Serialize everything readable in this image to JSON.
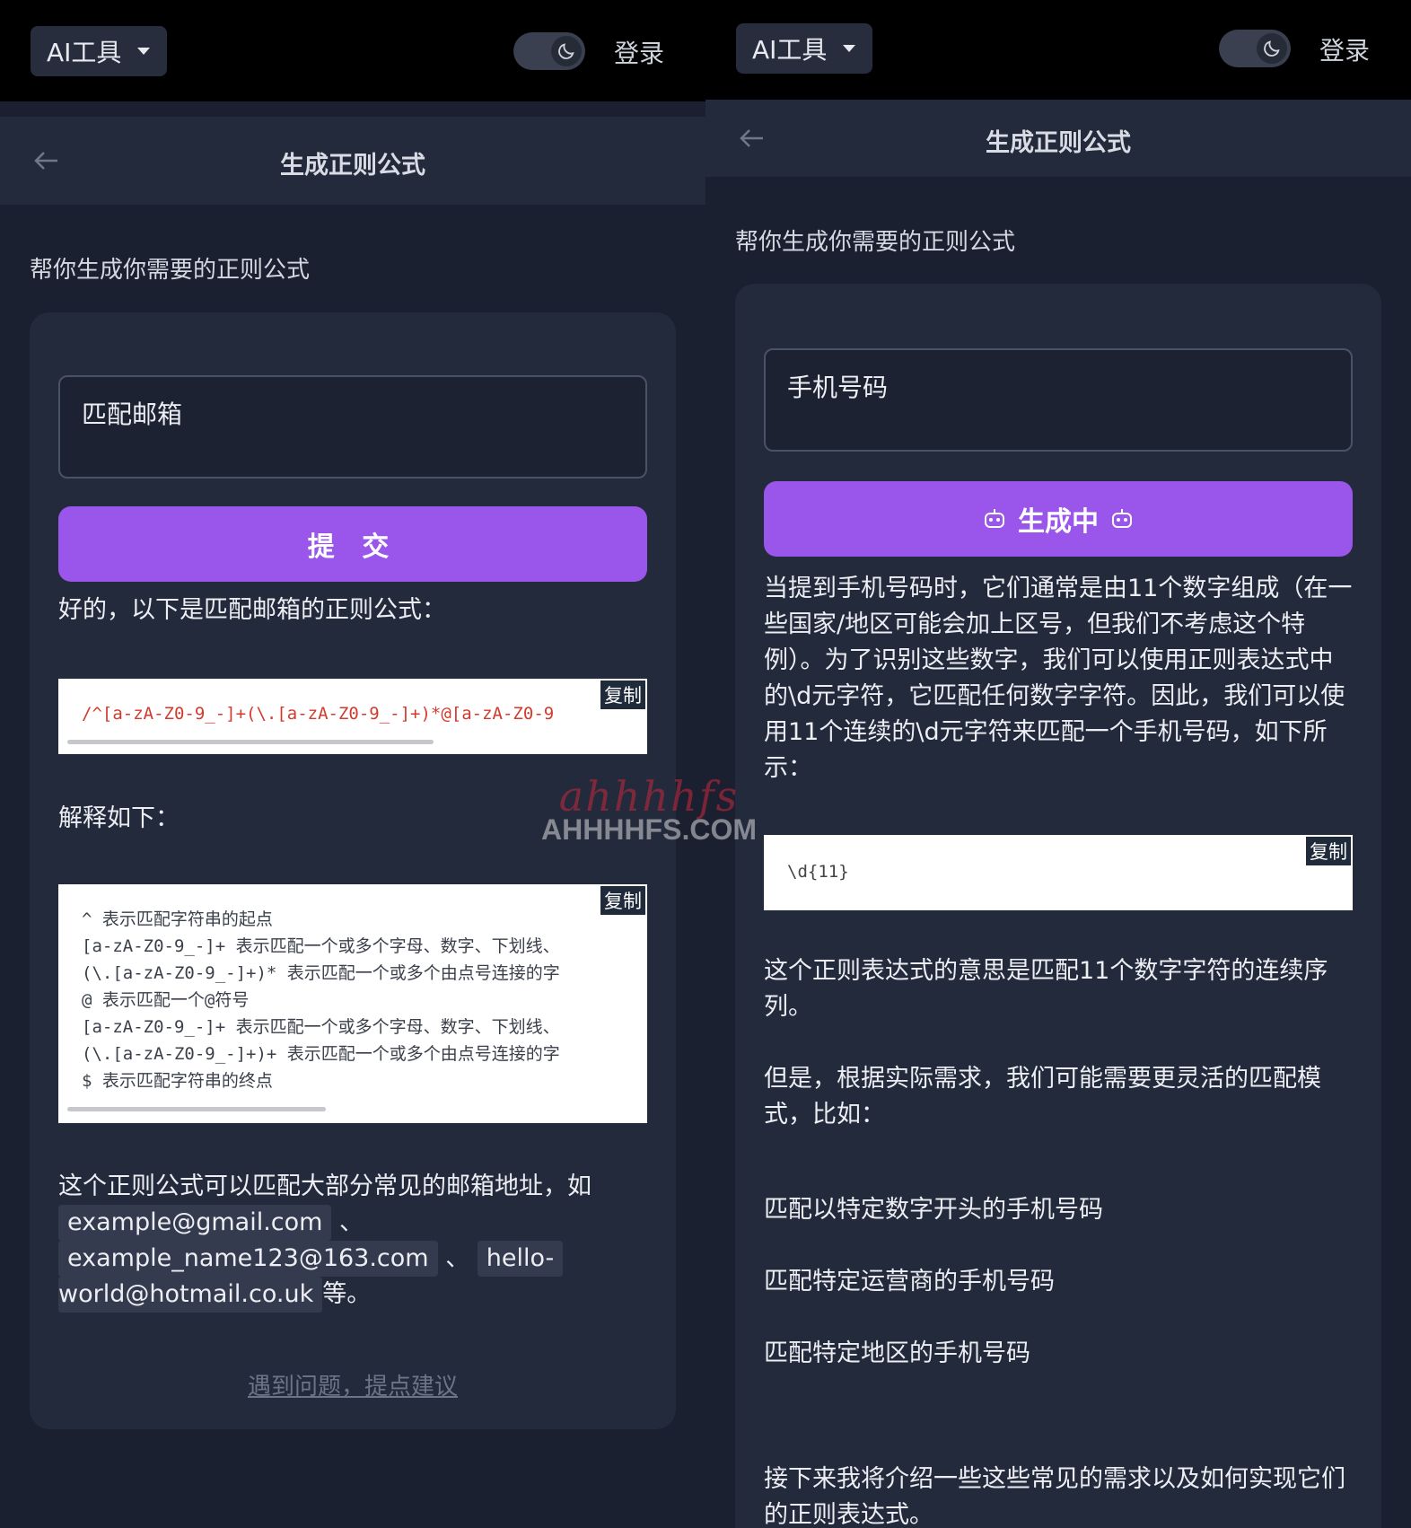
{
  "left": {
    "topbar": {
      "ai_tools": "AI工具",
      "login": "登录"
    },
    "header": {
      "title": "生成正则公式"
    },
    "intro": "帮你生成你需要的正则公式",
    "query": "匹配邮箱",
    "submit": "提 交",
    "answer_intro": "好的，以下是匹配邮箱的正则公式：",
    "code1": {
      "copy": "复制",
      "text": "/^[a-zA-Z0-9_-]+(\\.[a-zA-Z0-9_-]+)*@[a-zA-Z0-9"
    },
    "explain_heading": "解释如下：",
    "code2": {
      "copy": "复制",
      "lines": [
        "^ 表示匹配字符串的起点",
        "[a-zA-Z0-9_-]+ 表示匹配一个或多个字母、数字、下划线、",
        "(\\.[a-zA-Z0-9_-]+)* 表示匹配一个或多个由点号连接的字",
        "@ 表示匹配一个@符号",
        "[a-zA-Z0-9_-]+ 表示匹配一个或多个字母、数字、下划线、",
        "(\\.[a-zA-Z0-9_-]+)+ 表示匹配一个或多个由点号连接的字",
        "$ 表示匹配字符串的终点"
      ]
    },
    "summary": {
      "prefix": "这个正则公式可以匹配大部分常见的邮箱地址，如",
      "ex1": "example@gmail.com",
      "sep1": "、",
      "ex2": "example_name123@163.com",
      "sep2": "、",
      "ex3a": "hello-",
      "ex3b": "world@hotmail.co.uk",
      "suffix": "等。"
    },
    "feedback": "遇到问题，提点建议"
  },
  "right": {
    "topbar": {
      "ai_tools": "AI工具",
      "login": "登录"
    },
    "header": {
      "title": "生成正则公式"
    },
    "intro": "帮你生成你需要的正则公式",
    "query": "手机号码",
    "submit": "生成中",
    "answer": "当提到手机号码时，它们通常是由11个数字组成（在一些国家/地区可能会加上区号，但我们不考虑这个特例）。为了识别这些数字，我们可以使用正则表达式中的\\d元字符，它匹配任何数字字符。因此，我们可以使用11个连续的\\d元字符来匹配一个手机号码，如下所示：",
    "code": {
      "copy": "复制",
      "text": "\\d{11}"
    },
    "meaning": "这个正则表达式的意思是匹配11个数字字符的连续序列。",
    "however": "但是，根据实际需求，我们可能需要更灵活的匹配模式，比如：",
    "items": [
      "匹配以特定数字开头的手机号码",
      "匹配特定运营商的手机号码",
      "匹配特定地区的手机号码"
    ],
    "next": "接下来我将介绍一些这些常见的需求以及如何实现它们的正则表达式。"
  },
  "watermark": {
    "brand": "ahhhhfs",
    "domain": "AHHHHFS.COM"
  },
  "colors": {
    "accent": "#9a55ea",
    "code_red": "#d23a2e",
    "bg": "#1b2030",
    "card": "#232a3b"
  }
}
